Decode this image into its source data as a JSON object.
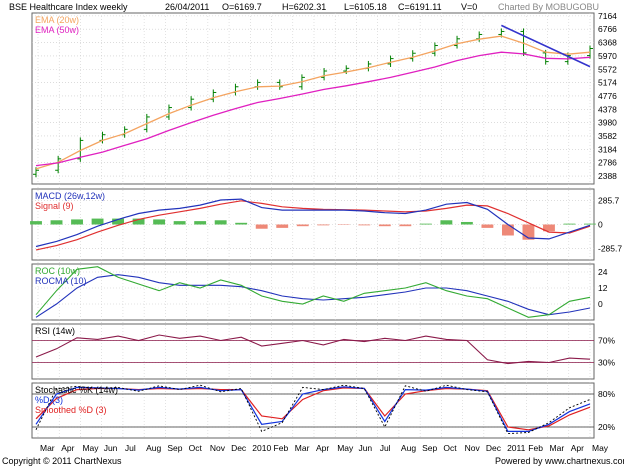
{
  "header": {
    "title": "BSE Healthcare Index weekly",
    "date": "26/04/2011",
    "open": "O=6169.7",
    "high": "H=6202.31",
    "low": "L=6105.18",
    "close": "C=6191.11",
    "volume": "V=0",
    "credit": "Charted By MOBUGOBU"
  },
  "footer": {
    "copyright": "Copyright © 2011 ChartNexus",
    "powered": "Powered by www.chartnexus.com"
  },
  "x_axis": {
    "labels": [
      "Mar",
      "Apr",
      "May",
      "Jun",
      "Jul",
      "Aug",
      "Sep",
      "Oct",
      "Nov",
      "Dec",
      "2010",
      "Feb",
      "Mar",
      "Apr",
      "May",
      "Jun",
      "Jul",
      "Aug",
      "Sep",
      "Oct",
      "Nov",
      "Dec",
      "2011",
      "Feb",
      "Mar",
      "Apr",
      "May"
    ]
  },
  "colors": {
    "candle": "#008000",
    "ema20": "#f4a460",
    "ema50": "#e020c0",
    "trend": "#3333cc",
    "macd": "#2233bb",
    "signal": "#e03030",
    "hist_pos": "#55bb55",
    "hist_neg": "#ee8877",
    "roc": "#33aa33",
    "rocma": "#2233bb",
    "rsi": "#8b1a4a",
    "stoch_k": "#000000",
    "stoch_d": "#1133dd",
    "smoothed_d": "#e02020",
    "grid": "#b0b0b0"
  },
  "chart_data": [
    {
      "panel": "price",
      "type": "candlestick",
      "legend": [
        "EMA (20w)",
        "EMA (50w)"
      ],
      "y_ticks": [
        7164,
        6766,
        6368,
        5970,
        5572,
        5174,
        4776,
        4378,
        3980,
        3582,
        3184,
        2786,
        2388
      ],
      "ylim": [
        2150,
        7250
      ],
      "x": [
        "2009-03",
        "2009-04",
        "2009-05",
        "2009-06",
        "2009-07",
        "2009-08",
        "2009-09",
        "2009-10",
        "2009-11",
        "2009-12",
        "2010-01",
        "2010-02",
        "2010-03",
        "2010-04",
        "2010-05",
        "2010-06",
        "2010-07",
        "2010-08",
        "2010-09",
        "2010-10",
        "2010-11",
        "2010-12",
        "2011-01",
        "2011-02",
        "2011-03",
        "2011-04"
      ],
      "close": [
        2560,
        2900,
        3450,
        3620,
        3780,
        4150,
        4430,
        4680,
        4880,
        5050,
        5180,
        5050,
        5330,
        5520,
        5600,
        5730,
        5890,
        6050,
        6280,
        6480,
        6610,
        6700,
        6060,
        5800,
        5980,
        6191
      ],
      "ema20": [
        2600,
        2800,
        3150,
        3450,
        3650,
        3950,
        4250,
        4500,
        4720,
        4900,
        5050,
        5070,
        5200,
        5380,
        5490,
        5620,
        5780,
        5930,
        6120,
        6330,
        6470,
        6560,
        6350,
        6080,
        6020,
        6080
      ],
      "ema50": [
        2700,
        2780,
        2950,
        3100,
        3300,
        3500,
        3750,
        3980,
        4200,
        4400,
        4580,
        4700,
        4830,
        4970,
        5080,
        5200,
        5330,
        5480,
        5640,
        5830,
        5980,
        6080,
        6030,
        5900,
        5880,
        5930
      ],
      "trendline": {
        "from": {
          "x": "2010-12",
          "y": 6880
        },
        "to": {
          "x": "2011-04",
          "y": 5650
        }
      }
    },
    {
      "panel": "macd",
      "type": "line+bar",
      "legend": [
        "MACD (26w,12w)",
        "Signal (9)"
      ],
      "y_ticks": [
        285.7,
        0,
        -285.7
      ],
      "ylim": [
        -420,
        420
      ],
      "macd": [
        -260,
        -200,
        -120,
        -20,
        60,
        130,
        170,
        190,
        230,
        290,
        300,
        200,
        170,
        170,
        170,
        170,
        160,
        140,
        130,
        170,
        240,
        260,
        180,
        0,
        -160,
        -170,
        -90,
        -10
      ],
      "signal": [
        -300,
        -250,
        -180,
        -90,
        -10,
        60,
        110,
        150,
        190,
        240,
        280,
        250,
        210,
        190,
        180,
        175,
        170,
        160,
        150,
        160,
        190,
        230,
        220,
        130,
        20,
        -90,
        -100,
        -20
      ],
      "histogram": [
        40,
        50,
        60,
        70,
        70,
        70,
        60,
        40,
        40,
        50,
        20,
        -50,
        -40,
        -20,
        -10,
        -5,
        -10,
        -20,
        -20,
        10,
        50,
        30,
        -40,
        -130,
        -180,
        -80,
        10,
        10
      ]
    },
    {
      "panel": "roc",
      "type": "line",
      "legend": [
        "ROC (10w)",
        "ROCMA (10)"
      ],
      "y_ticks": [
        24,
        12,
        0
      ],
      "ylim": [
        -12,
        30
      ],
      "roc": [
        -8,
        10,
        26,
        28,
        20,
        15,
        10,
        16,
        12,
        18,
        14,
        6,
        2,
        0,
        6,
        2,
        8,
        10,
        12,
        16,
        10,
        6,
        4,
        -3,
        -10,
        -8,
        2,
        5
      ],
      "rocma": [
        -10,
        0,
        12,
        20,
        22,
        20,
        16,
        14,
        14,
        14,
        13,
        10,
        6,
        4,
        3,
        4,
        5,
        7,
        9,
        12,
        12,
        10,
        6,
        2,
        -4,
        -8,
        -6,
        -3
      ]
    },
    {
      "panel": "rsi",
      "type": "line",
      "legend": [
        "RSI (14w)"
      ],
      "y_ticks": [
        "70%",
        "30%"
      ],
      "ylim": [
        0,
        100
      ],
      "rsi": [
        40,
        55,
        75,
        72,
        78,
        70,
        80,
        74,
        78,
        70,
        76,
        60,
        65,
        70,
        62,
        72,
        68,
        74,
        70,
        78,
        72,
        70,
        35,
        28,
        32,
        30,
        38,
        36
      ]
    },
    {
      "panel": "stochastic",
      "type": "line",
      "legend": [
        "Stochastic %K (14w)",
        "%D (3)",
        "Smoothed %D (3)"
      ],
      "y_ticks": [
        "80%",
        "20%"
      ],
      "ylim": [
        0,
        100
      ],
      "k": [
        15,
        90,
        94,
        90,
        92,
        85,
        95,
        88,
        96,
        84,
        90,
        12,
        28,
        92,
        88,
        96,
        90,
        20,
        95,
        85,
        96,
        88,
        84,
        8,
        10,
        28,
        55,
        70
      ],
      "d": [
        25,
        80,
        92,
        91,
        90,
        87,
        92,
        89,
        92,
        86,
        88,
        25,
        30,
        80,
        88,
        93,
        90,
        30,
        88,
        87,
        92,
        89,
        85,
        12,
        12,
        25,
        48,
        62
      ],
      "smoothed_d": [
        35,
        72,
        88,
        90,
        90,
        88,
        90,
        89,
        90,
        88,
        88,
        40,
        35,
        70,
        86,
        91,
        90,
        40,
        80,
        86,
        90,
        89,
        86,
        20,
        15,
        22,
        42,
        56
      ]
    }
  ]
}
